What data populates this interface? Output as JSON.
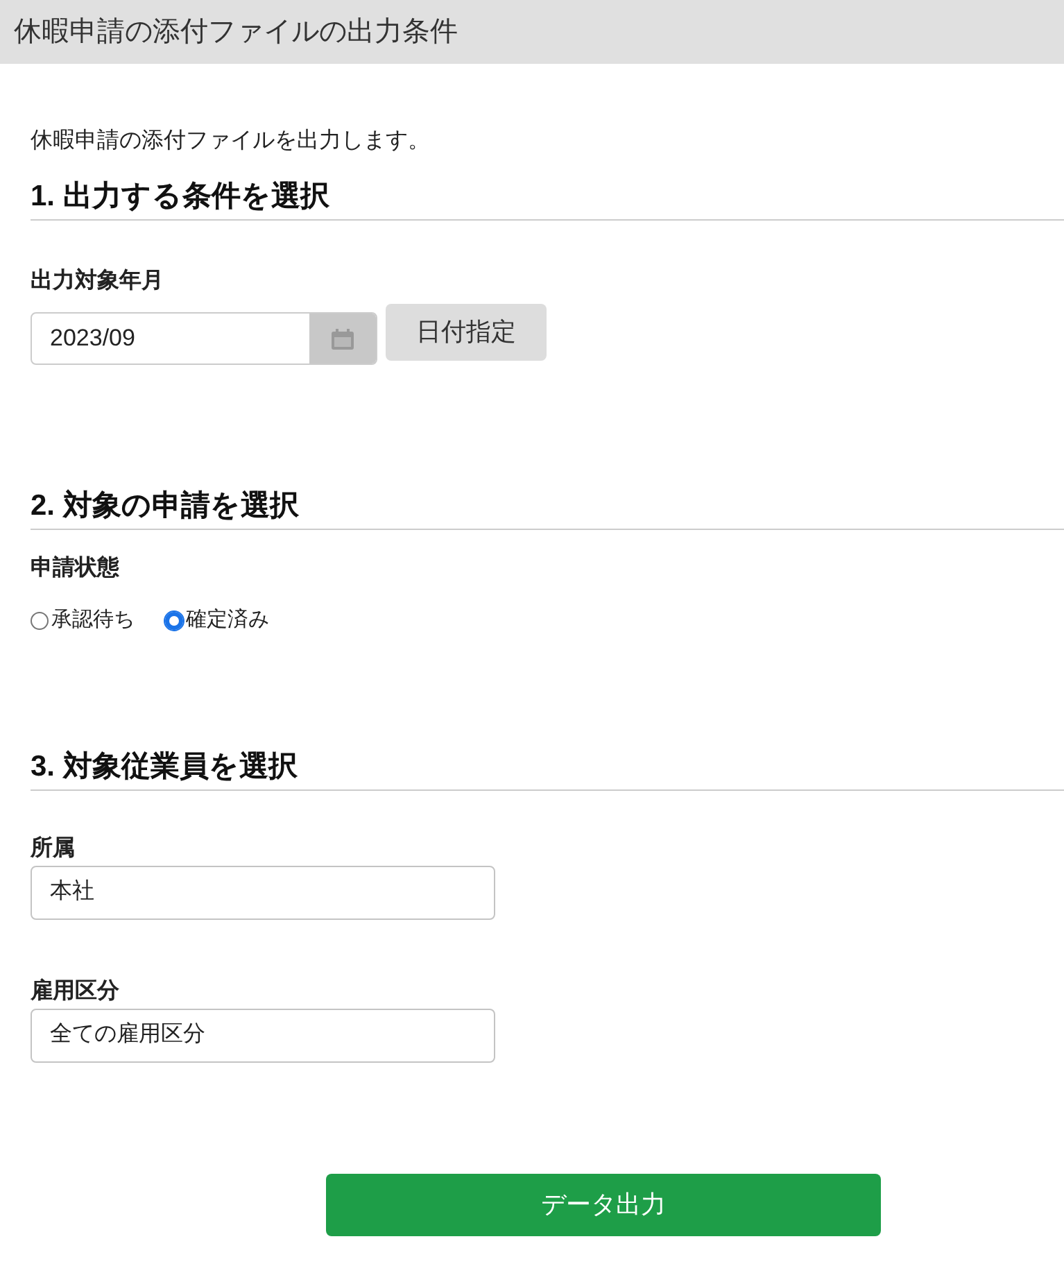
{
  "header": {
    "title": "休暇申請の添付ファイルの出力条件"
  },
  "intro": "休暇申請の添付ファイルを出力します。",
  "section1": {
    "heading": "1. 出力する条件を選択",
    "label": "出力対象年月",
    "value": "2023/09",
    "button": "日付指定"
  },
  "section2": {
    "heading": "2. 対象の申請を選択",
    "label": "申請状態",
    "options": [
      {
        "label": "承認待ち",
        "selected": false
      },
      {
        "label": "確定済み",
        "selected": true
      }
    ]
  },
  "section3": {
    "heading": "3. 対象従業員を選択",
    "fields": [
      {
        "label": "所属",
        "value": "本社"
      },
      {
        "label": "雇用区分",
        "value": "全ての雇用区分"
      }
    ]
  },
  "submit": "データ出力"
}
